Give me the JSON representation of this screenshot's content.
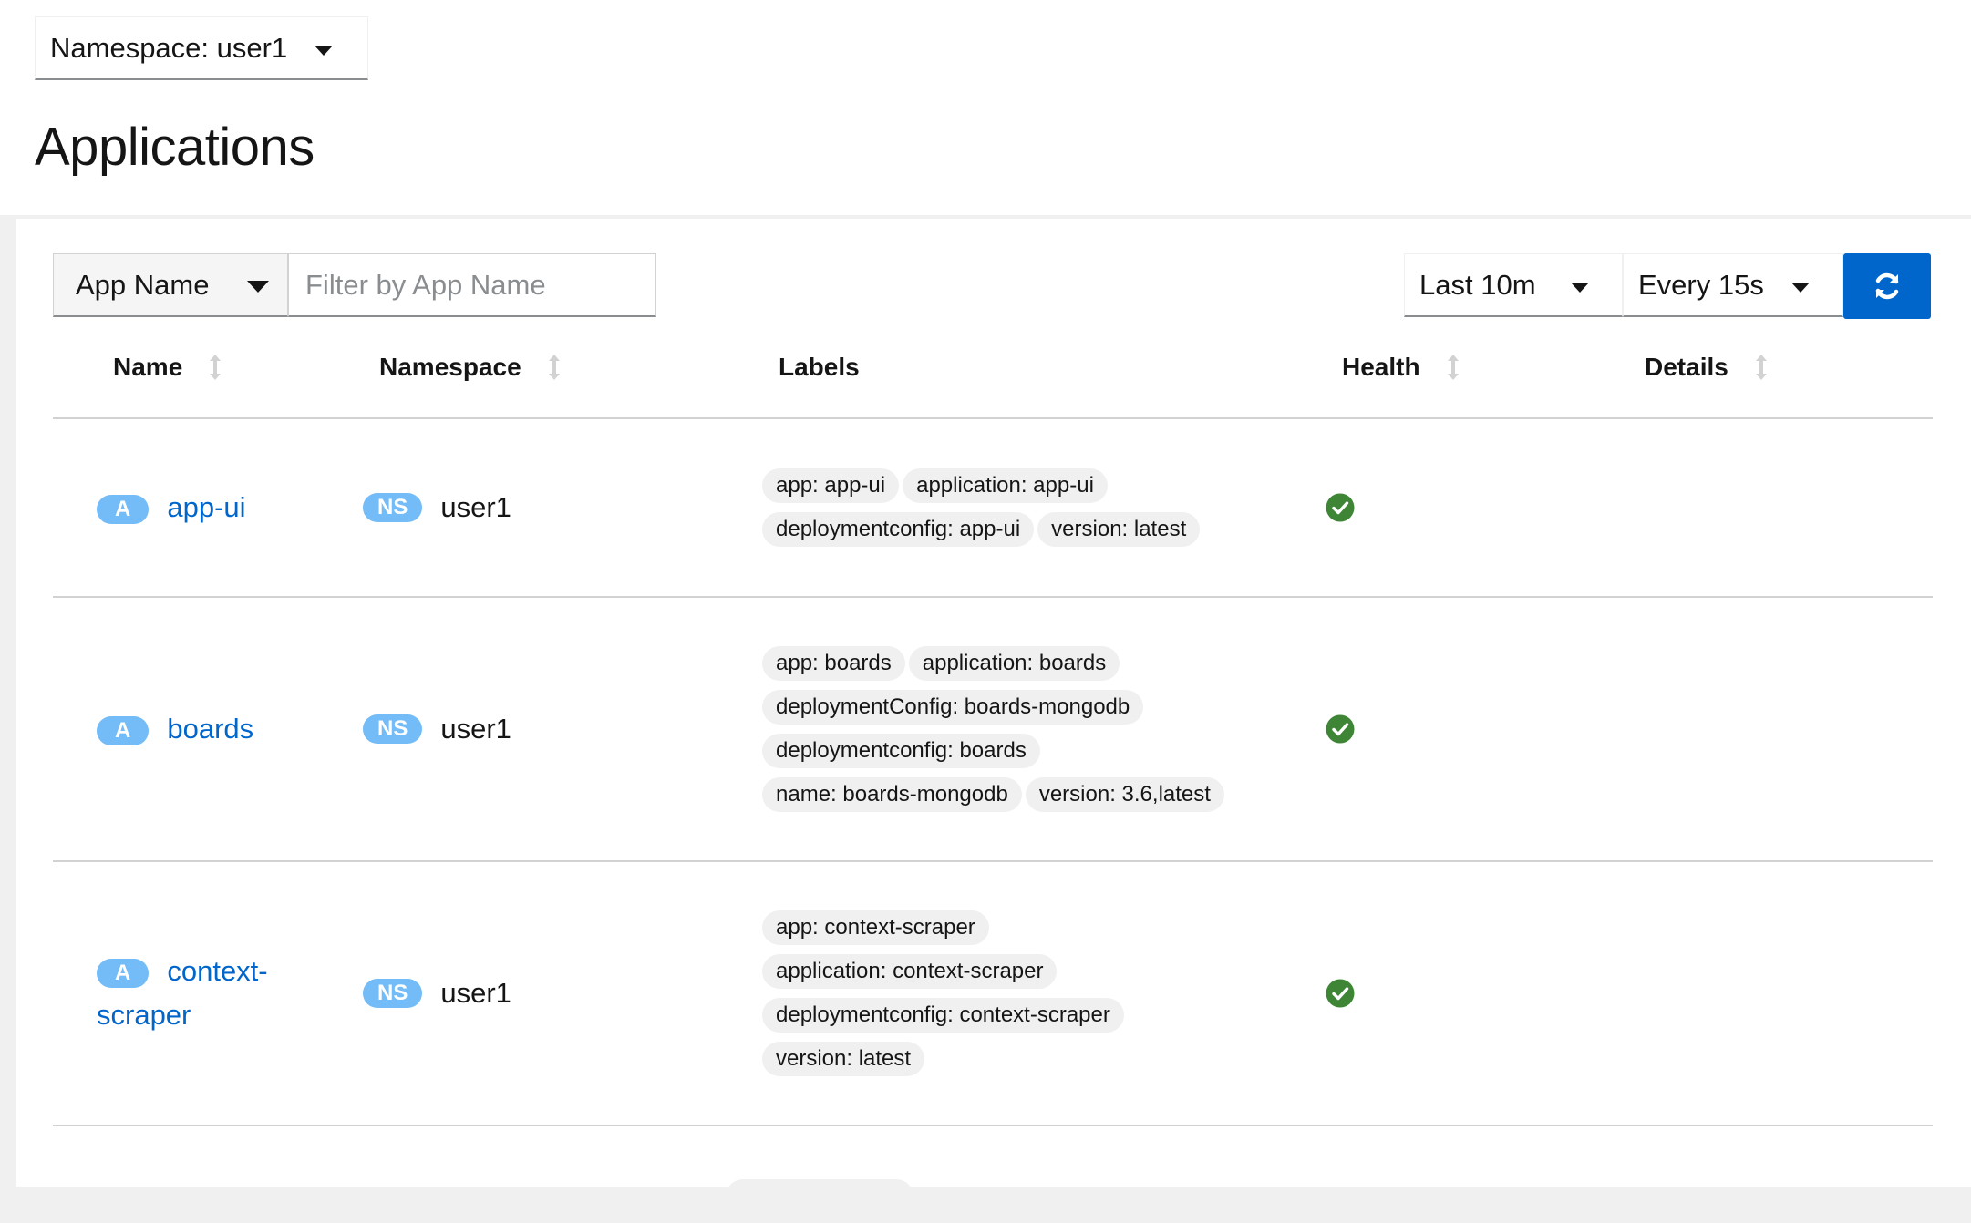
{
  "namespace_selector": {
    "label": "Namespace: user1"
  },
  "page": {
    "title": "Applications"
  },
  "toolbar": {
    "filter_type": "App Name",
    "filter_placeholder": "Filter by App Name",
    "duration": "Last 10m",
    "refresh_interval": "Every 15s",
    "refresh_icon": "sync-icon"
  },
  "table": {
    "columns": [
      "Name",
      "Namespace",
      "Labels",
      "Health",
      "Details"
    ],
    "rows": [
      {
        "badge": "A",
        "name": "app-ui",
        "ns_badge": "NS",
        "namespace": "user1",
        "label_lines": [
          [
            "app: app-ui",
            "application: app-ui"
          ],
          [
            "deploymentconfig: app-ui",
            "version: latest"
          ]
        ],
        "health": "healthy"
      },
      {
        "badge": "A",
        "name": "boards",
        "ns_badge": "NS",
        "namespace": "user1",
        "label_lines": [
          [
            "app: boards",
            "application: boards"
          ],
          [
            "deploymentConfig: boards-mongodb"
          ],
          [
            "deploymentconfig: boards"
          ],
          [
            "name: boards-mongodb",
            "version: 3.6,latest"
          ]
        ],
        "health": "healthy"
      },
      {
        "badge": "A",
        "name": "context-scraper",
        "name_line1": "context-",
        "name_line2": "scraper",
        "ns_badge": "NS",
        "namespace": "user1",
        "label_lines": [
          [
            "app: context-scraper"
          ],
          [
            "application: context-scraper"
          ],
          [
            "deploymentconfig: context-scraper"
          ],
          [
            "version: latest"
          ]
        ],
        "health": "healthy"
      }
    ]
  },
  "colors": {
    "link": "#0066cc",
    "badge": "#73bcf7",
    "healthy": "#3e8635",
    "primary": "#0066cc"
  }
}
